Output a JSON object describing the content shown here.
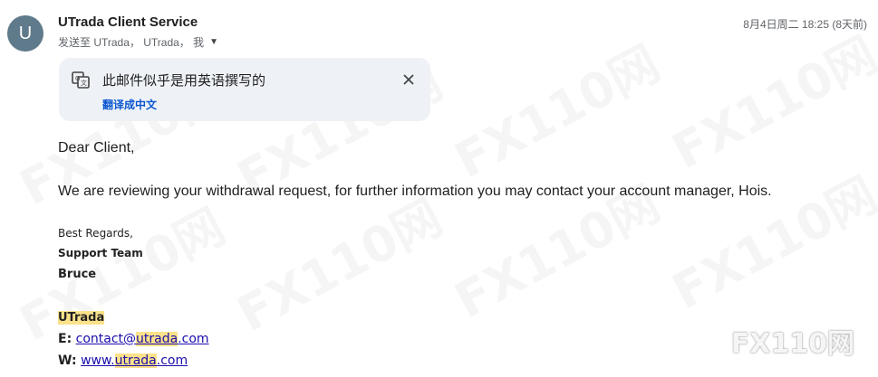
{
  "header": {
    "avatar_letter": "U",
    "sender": "UTrada Client Service",
    "recipients": "发送至 UTrada， UTrada， 我",
    "date": "8月4日周二 18:25 (8天前)"
  },
  "translate": {
    "title": "此邮件似乎是用英语撰写的",
    "link": "翻译成中文"
  },
  "body": {
    "greeting": "Dear Client,",
    "message": "We are reviewing your withdrawal request, for further information you may contact your account manager, Hois."
  },
  "signature": {
    "regards": "Best Regards,",
    "team": "Support Team",
    "name": "Bruce",
    "company": "UTrada",
    "email_label": "E:",
    "email_prefix": "contact@",
    "email_highlight": "utrada",
    "email_suffix": ".com",
    "web_label": "W:",
    "web_prefix": "www.",
    "web_highlight": "utrada",
    "web_suffix": ".com"
  },
  "watermark": {
    "text": "FX110网"
  },
  "colors": {
    "highlight": "#fbe28a",
    "link": "#1a0dab",
    "translate_link": "#0b57d0",
    "card_bg": "#eef2f7"
  }
}
